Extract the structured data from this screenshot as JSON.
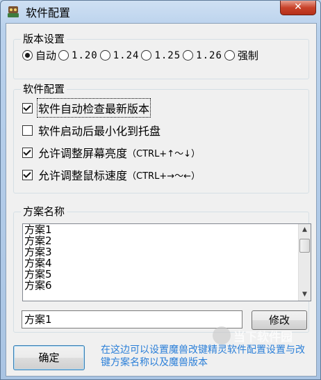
{
  "window": {
    "title": "软件配置",
    "close_glyph": "✕"
  },
  "version_group": {
    "legend": "版本设置",
    "options": [
      {
        "label": "自动",
        "selected": true,
        "mono": false
      },
      {
        "label": "1.20",
        "selected": false,
        "mono": true
      },
      {
        "label": "1.24",
        "selected": false,
        "mono": true
      },
      {
        "label": "1.25",
        "selected": false,
        "mono": true
      },
      {
        "label": "1.26",
        "selected": false,
        "mono": true
      },
      {
        "label": "强制",
        "selected": false,
        "mono": false
      }
    ]
  },
  "software_group": {
    "legend": "软件配置",
    "checkboxes": [
      {
        "label": "软件自动检查最新版本",
        "suffix": "",
        "checked": true
      },
      {
        "label": "软件启动后最小化到托盘",
        "suffix": "",
        "checked": false
      },
      {
        "label": "允许调整屏幕亮度",
        "suffix": "（CTRL+↑～↓）",
        "checked": true
      },
      {
        "label": "允许调整鼠标速度",
        "suffix": "（CTRL+→～←）",
        "checked": true
      }
    ]
  },
  "scheme_group": {
    "legend": "方案名称",
    "items": [
      "方案1",
      "方案2",
      "方案3",
      "方案4",
      "方案5",
      "方案6"
    ],
    "input_value": "方案1",
    "modify_label": "修改"
  },
  "footer": {
    "ok_label": "确定",
    "hint": "在这边可以设置魔兽改键精灵软件配置设置与改键方案名称以及魔兽版本"
  },
  "watermark": {
    "text": "当下软件园"
  }
}
